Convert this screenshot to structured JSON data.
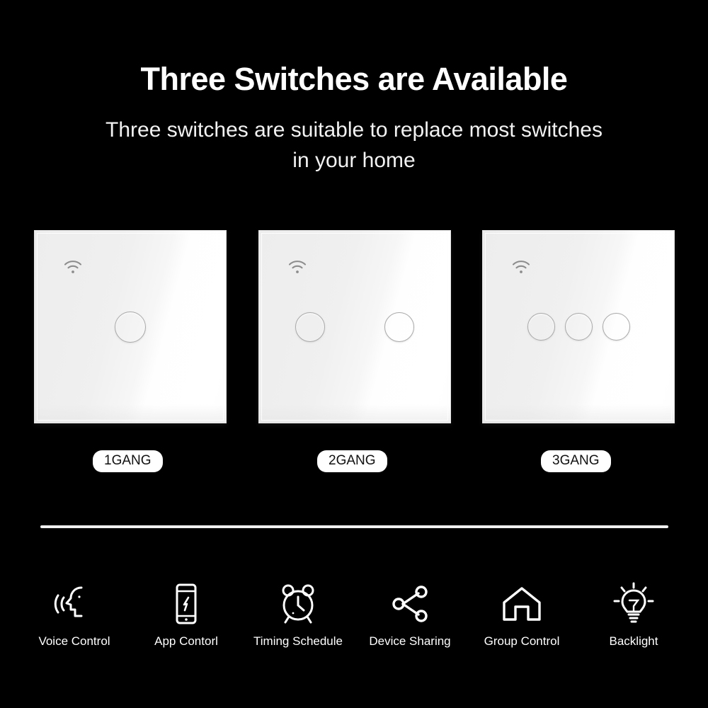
{
  "heading": "Three Switches are Available",
  "subheading": "Three switches are suitable to replace most switches in your home",
  "colors": {
    "background": "#000000",
    "text": "#ffffff",
    "panel": "#f4f4f4",
    "panel_border": "#e3e3e3",
    "button_stroke": "#a9a9a9",
    "wifi_icon": "#8c8c8c",
    "label_pill_bg": "#ffffff",
    "label_pill_text": "#111111",
    "divider": "#f0f0f0"
  },
  "switches": [
    {
      "label": "1GANG",
      "gang_count": 1,
      "wifi_icon": "wifi-icon",
      "button_icon": "circle-touch-button"
    },
    {
      "label": "2GANG",
      "gang_count": 2,
      "wifi_icon": "wifi-icon",
      "button_icon": "circle-touch-button"
    },
    {
      "label": "3GANG",
      "gang_count": 3,
      "wifi_icon": "wifi-icon",
      "button_icon": "circle-touch-button"
    }
  ],
  "features": [
    {
      "label": "Voice Control",
      "icon": "voice-control-icon"
    },
    {
      "label": "App Contorl",
      "icon": "smartphone-app-icon"
    },
    {
      "label": "Timing Schedule",
      "icon": "alarm-clock-icon"
    },
    {
      "label": "Device Sharing",
      "icon": "share-nodes-icon"
    },
    {
      "label": "Group Control",
      "icon": "house-icon"
    },
    {
      "label": "Backlight",
      "icon": "light-bulb-icon"
    }
  ]
}
